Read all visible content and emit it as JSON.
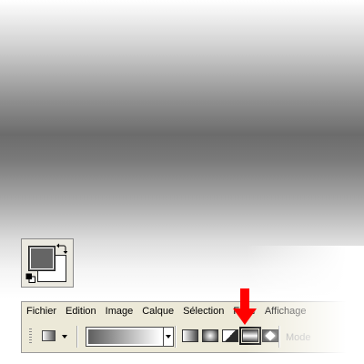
{
  "menu": [
    "Fichier",
    "Edition",
    "Image",
    "Calque",
    "Sélection",
    "Filtre",
    "Affichage"
  ],
  "options_bar": {
    "mode_label": "Mode",
    "gradient_types": [
      "linear-gradient-icon",
      "radial-gradient-icon",
      "angle-gradient-icon",
      "reflected-gradient-icon",
      "diamond-gradient-icon"
    ],
    "selected_gradient_type": "reflected-gradient-icon"
  },
  "swatch": {
    "foreground_color": "#656565",
    "background_color": "#ffffff"
  },
  "canvas": {
    "gradient_from": "#ffffff",
    "gradient_mid": "#6c6c6c"
  },
  "arrow_color": "#ff0000"
}
